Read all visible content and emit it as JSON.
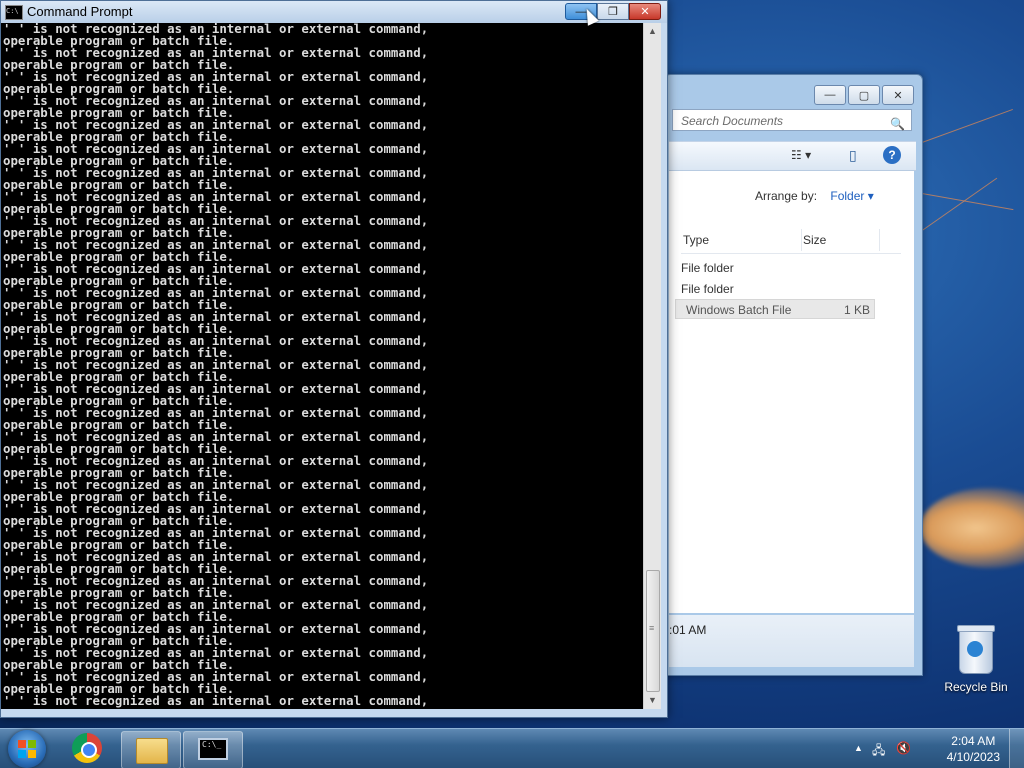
{
  "cmd_window": {
    "title": "Command Prompt",
    "icon_text": "C:\\",
    "buttons": {
      "minimize": "—",
      "restore": "❐",
      "close": "✕"
    },
    "console_lines": [
      "' ' is not recognized as an internal or external command,",
      "operable program or batch file."
    ],
    "repeat_count": 28,
    "last_line": "' ' is not recognized as an internal or external command,",
    "scroll": {
      "up": "▲",
      "down": "▼",
      "grip": "≡"
    }
  },
  "explorer_window": {
    "buttons": {
      "minimize": "—",
      "restore": "▢",
      "close": "✕"
    },
    "search_placeholder": "Search Documents",
    "search_icon": "🔍",
    "toolbar": {
      "view_icon": "☷ ▾",
      "pane_icon": "▯",
      "help_icon": "?"
    },
    "arrange_label": "Arrange by:",
    "arrange_value": "Folder ▾",
    "columns": [
      "Type",
      "Size"
    ],
    "rows": [
      {
        "type": "File folder",
        "size": ""
      },
      {
        "type": "File folder",
        "size": ""
      },
      {
        "type": "Windows Batch File",
        "size": "1 KB"
      }
    ],
    "status_text": ":01 AM"
  },
  "desktop": {
    "recycle_bin_label": "Recycle Bin"
  },
  "taskbar": {
    "clock_time": "2:04 AM",
    "clock_date": "4/10/2023",
    "tray_up": "▲",
    "tray_network": "🖧",
    "tray_volume": "🔇",
    "cmd_icon_text": "C:\\_"
  },
  "colors": {
    "console_bg": "#000000",
    "console_fg": "#dcdcdc",
    "accent": "#1e5fbf"
  }
}
